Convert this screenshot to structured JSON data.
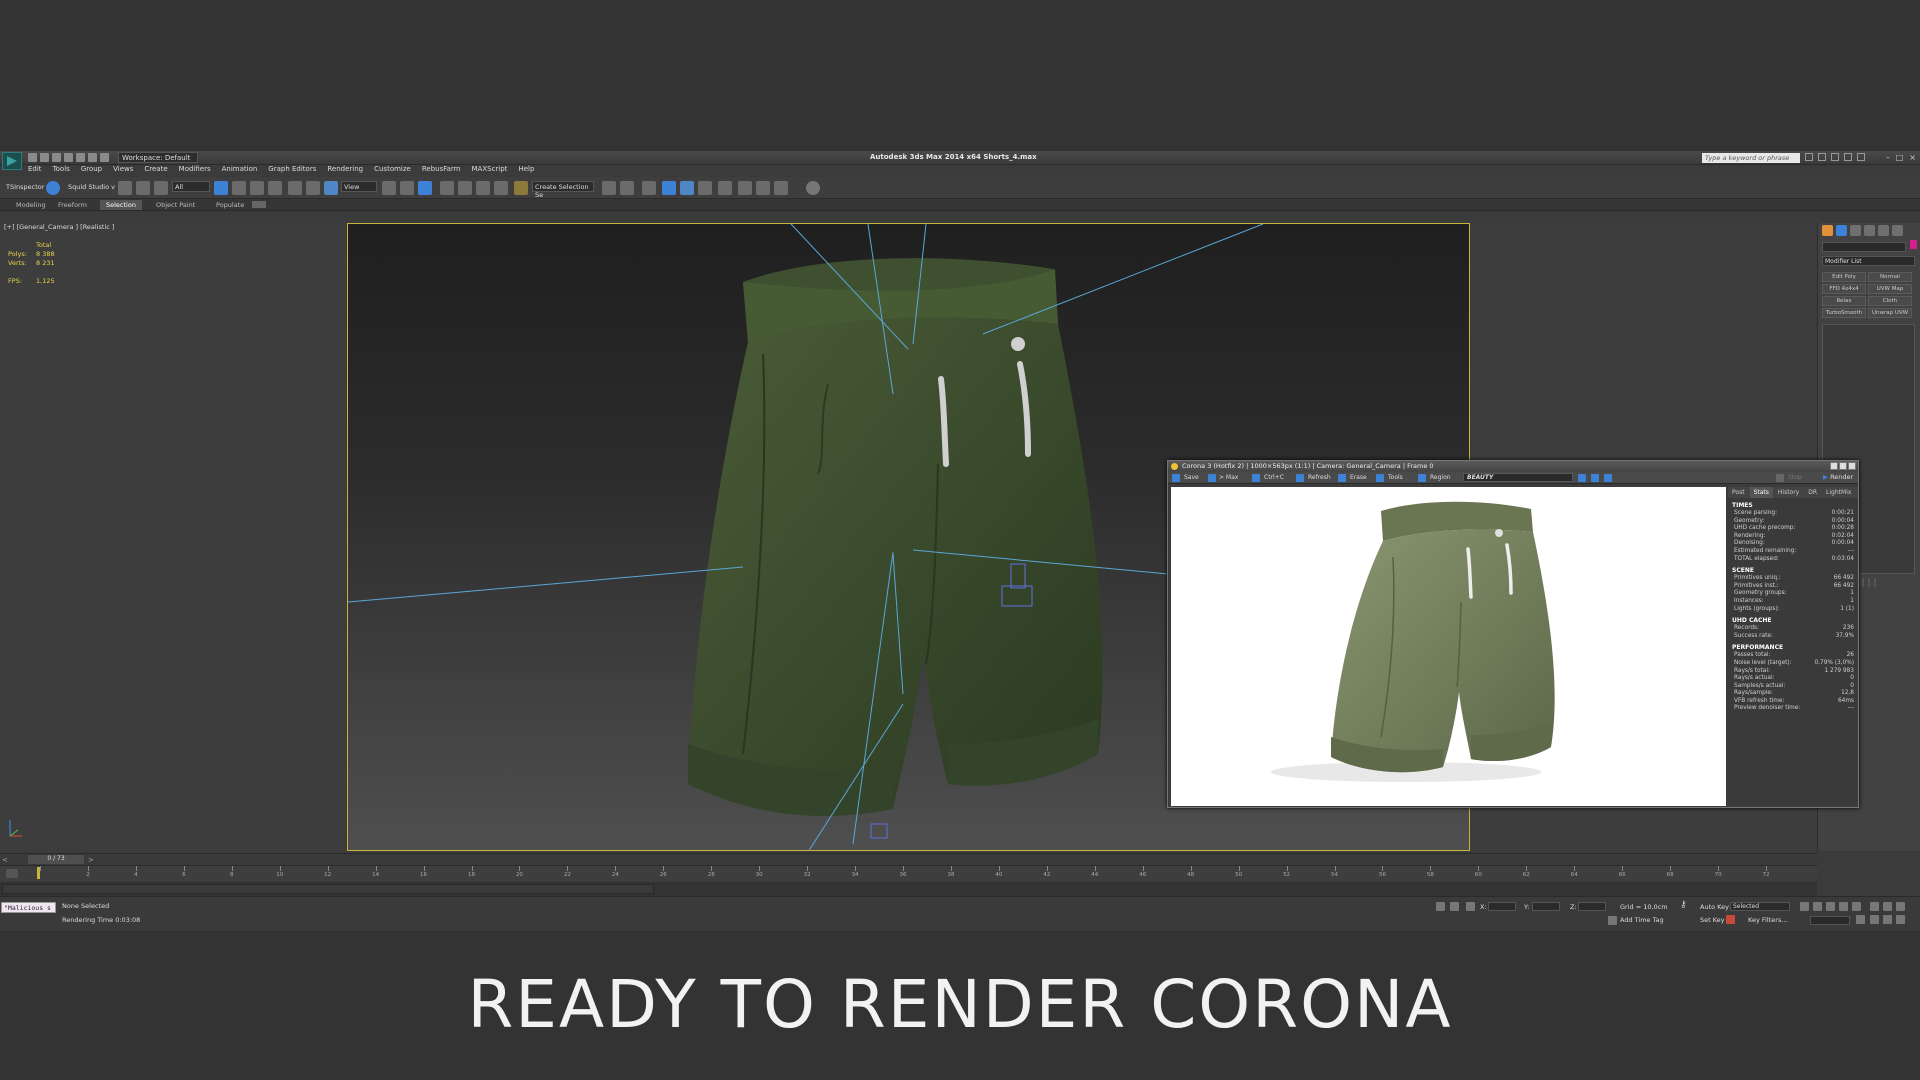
{
  "app": {
    "title": "Autodesk 3ds Max  2014 x64    Shorts_4.max",
    "workspace": "Workspace: Default",
    "search_placeholder": "Type a keyword or phrase",
    "window_controls": [
      "–",
      "□",
      "×"
    ]
  },
  "menu": [
    "Edit",
    "Tools",
    "Group",
    "Views",
    "Create",
    "Modifiers",
    "Animation",
    "Graph Editors",
    "Rendering",
    "Customize",
    "RebusFarm",
    "MAXScript",
    "Help"
  ],
  "toolbar": {
    "plugin_label": "TSInspector",
    "studio_label": "Squid Studio v",
    "filter_value": "All",
    "ref_coord_value": "View",
    "selection_set_value": "Create Selection Se"
  },
  "ribbon_tabs": [
    {
      "label": "Modeling",
      "active": false
    },
    {
      "label": "Freeform",
      "active": false
    },
    {
      "label": "Selection",
      "active": true
    },
    {
      "label": "Object Paint",
      "active": false
    },
    {
      "label": "Populate",
      "active": false
    }
  ],
  "viewport": {
    "label": "[+] [General_Camera ] [Realistic ]",
    "stats": {
      "header": "Total",
      "rows": [
        {
          "k": "Polys:",
          "v": "8 388"
        },
        {
          "k": "Verts:",
          "v": "8 231"
        }
      ],
      "fps_label": "FPS:",
      "fps_value": "1,125"
    }
  },
  "command_panel": {
    "modifier_list": "Modifier List",
    "modifiers": [
      "Edit Poly",
      "Normal",
      "FFD 4x4x4",
      "UVW Map",
      "Relax",
      "Cloth",
      "TurboSmooth",
      "Unwrap UVW"
    ]
  },
  "corona_vfb": {
    "title": "Corona 3 (Hotfix 2) | 1000×563px (1:1) | Camera: General_Camera | Frame 0",
    "toolbar": [
      "Save",
      "> Max",
      "Ctrl+C",
      "Refresh",
      "Erase",
      "Tools",
      "Region"
    ],
    "channel": "BEAUTY",
    "render_button": "Render",
    "stop_button": "Stop",
    "tabs": [
      {
        "label": "Post",
        "active": false
      },
      {
        "label": "Stats",
        "active": true
      },
      {
        "label": "History",
        "active": false
      },
      {
        "label": "DR",
        "active": false
      },
      {
        "label": "LightMix",
        "active": false
      }
    ],
    "sections": [
      {
        "title": "TIMES",
        "rows": [
          {
            "k": "Scene parsing:",
            "v": "0:00:21"
          },
          {
            "k": "Geometry:",
            "v": "0:00:04"
          },
          {
            "k": "UHD cache precomp:",
            "v": "0:00:28"
          },
          {
            "k": "Rendering:",
            "v": "0:02:04"
          },
          {
            "k": "Denoising:",
            "v": "0:00:04"
          },
          {
            "k": "Estimated remaining:",
            "v": "---"
          },
          {
            "k": "TOTAL elapsed:",
            "v": "0:03:04"
          }
        ]
      },
      {
        "title": "SCENE",
        "rows": [
          {
            "k": "Primitives uniq.:",
            "v": "66 492"
          },
          {
            "k": "Primitives inst.:",
            "v": "66 492"
          },
          {
            "k": "Geometry groups:",
            "v": "1"
          },
          {
            "k": "Instances:",
            "v": "1"
          },
          {
            "k": "Lights (groups):",
            "v": "1 (1)"
          }
        ]
      },
      {
        "title": "UHD CACHE",
        "rows": [
          {
            "k": "Records:",
            "v": "236"
          },
          {
            "k": "Success rate:",
            "v": "37,9%"
          }
        ]
      },
      {
        "title": "PERFORMANCE",
        "rows": [
          {
            "k": "Passes total:",
            "v": "26"
          },
          {
            "k": "Noise level (target):",
            "v": "0,79% (3,0%)"
          },
          {
            "k": "Rays/s total:",
            "v": "1 279 983"
          },
          {
            "k": "Rays/s actual:",
            "v": "0"
          },
          {
            "k": "Samples/s actual:",
            "v": "0"
          },
          {
            "k": "Rays/sample:",
            "v": "12,8"
          },
          {
            "k": "VFB refresh time:",
            "v": "64ms"
          },
          {
            "k": "Preview denoiser time:",
            "v": "---"
          }
        ]
      }
    ]
  },
  "timeline": {
    "frame_label": "0 / 73",
    "ticks": [
      "0",
      "2",
      "4",
      "6",
      "8",
      "10",
      "12",
      "14",
      "16",
      "18",
      "20",
      "22",
      "24",
      "26",
      "28",
      "30",
      "32",
      "34",
      "36",
      "38",
      "40",
      "42",
      "44",
      "46",
      "48",
      "50",
      "52",
      "54",
      "56",
      "58",
      "60",
      "62",
      "64",
      "66",
      "68",
      "70",
      "72"
    ]
  },
  "status": {
    "maxscript": "\"Malicious s",
    "selection": "None Selected",
    "render_time": "Rendering Time  0:03:08",
    "x_label": "X:",
    "y_label": "Y:",
    "z_label": "Z:",
    "grid": "Grid = 10,0cm",
    "add_time_tag": "Add Time Tag",
    "auto_key": "Auto Key",
    "auto_key_value": "Selected",
    "set_key": "Set Key",
    "key_filters": "Key Filters..."
  },
  "caption": "READY TO RENDER  CORONA",
  "colors": {
    "viewport_border": "#c9b43a",
    "stats_text": "#e6d54a",
    "shorts_viewport": "#3d4e2e",
    "shorts_render": "#6f7d5a",
    "light_lines": "#5aa7d6"
  }
}
